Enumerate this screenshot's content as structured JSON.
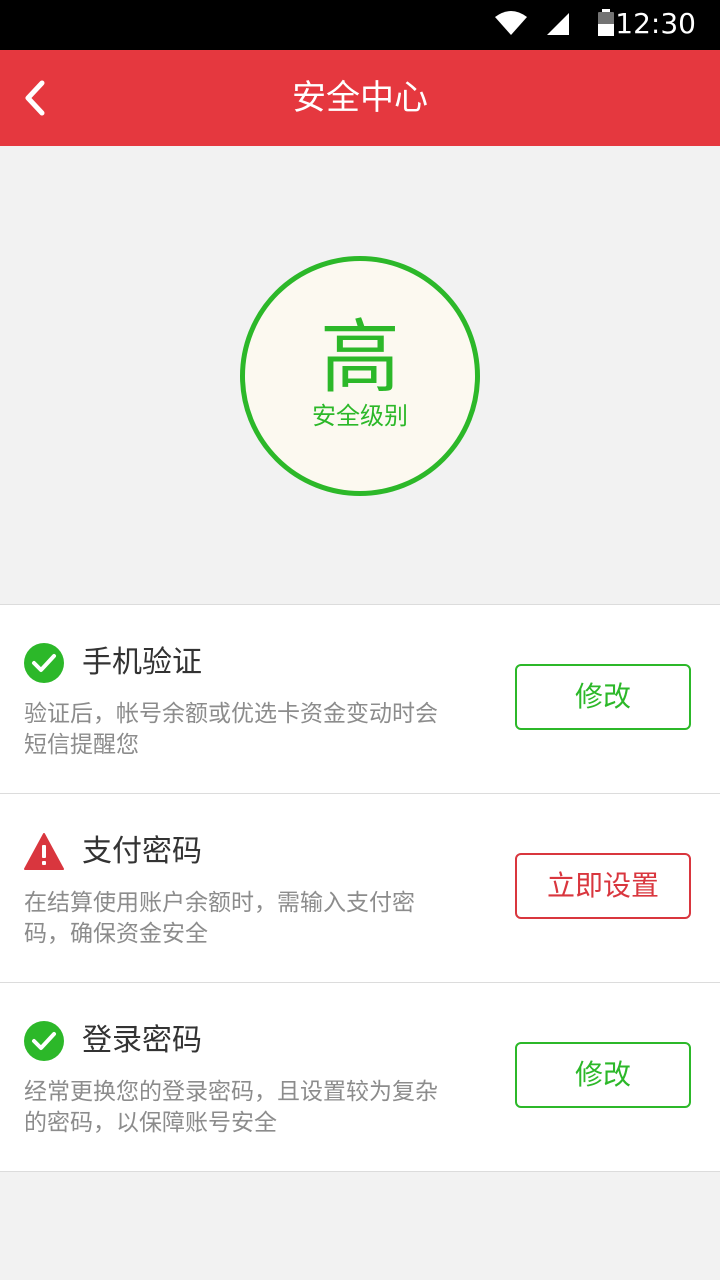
{
  "status_bar": {
    "time": "12:30"
  },
  "header": {
    "title": "安全中心"
  },
  "security_level": {
    "value": "高",
    "label": "安全级别",
    "color": "#2cb829"
  },
  "items": [
    {
      "status": "check-circle-icon",
      "title": "手机验证",
      "description": "验证后，帐号余额或优选卡资金变动时会短信提醒您",
      "action": "修改"
    },
    {
      "status": "warning-icon",
      "title": "支付密码",
      "description": "在结算使用账户余额时，需输入支付密码，确保资金安全",
      "action": "立即设置"
    },
    {
      "status": "check-circle-icon",
      "title": "登录密码",
      "description": "经常更换您的登录密码，且设置较为复杂的密码，以保障账号安全",
      "action": "修改"
    }
  ],
  "colors": {
    "accent": "#e5383f",
    "ok": "#2cb829",
    "warn": "#d9363e"
  }
}
